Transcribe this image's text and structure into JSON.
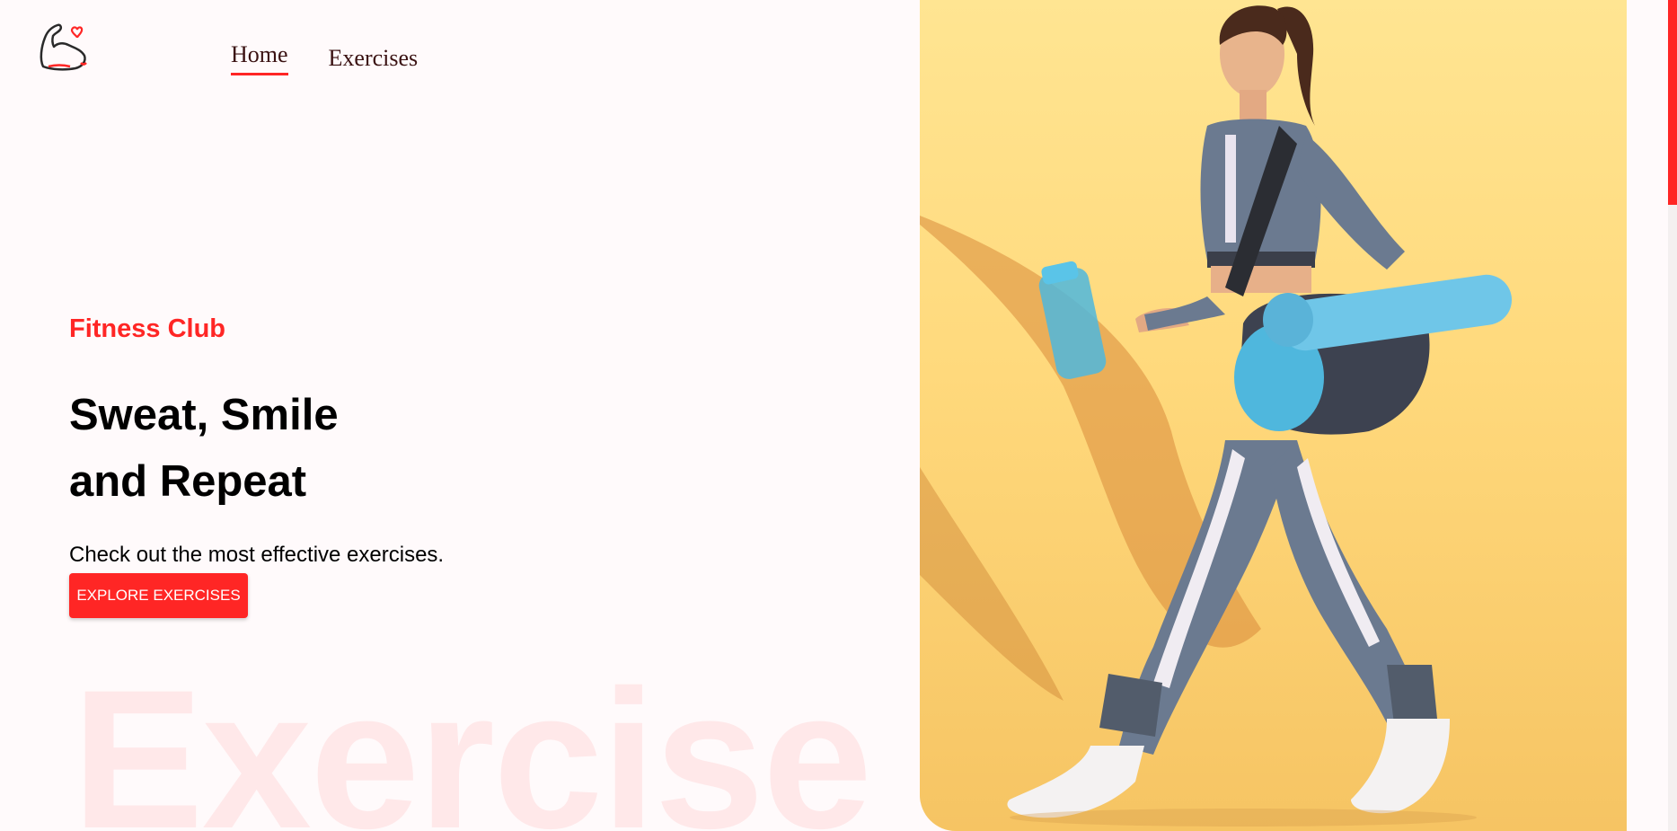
{
  "logo": {
    "icon": "flexed-arm-heart-icon"
  },
  "nav": {
    "home_label": "Home",
    "exercises_label": "Exercises"
  },
  "hero": {
    "subtitle": "Fitness Club",
    "title_line1": "Sweat, Smile",
    "title_line2": "and Repeat",
    "description": "Check out the most effective exercises.",
    "button_label": "EXPLORE EXERCISES",
    "watermark": "Exercise"
  },
  "colors": {
    "accent": "#ff2625",
    "background": "#fffafb",
    "banner_bg": "#ffd97c"
  }
}
